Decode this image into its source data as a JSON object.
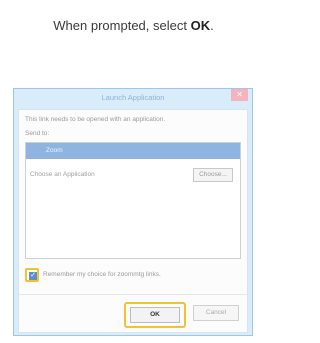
{
  "instruction": {
    "prefix": "When prompted, select ",
    "emphasis": "OK",
    "suffix": "."
  },
  "dialog": {
    "title": "Launch Application",
    "close_icon": "close-icon",
    "message": "This link needs to be opened with an application.",
    "send_to_label": "Send to:",
    "selected_item": "Zoom",
    "choose_label": "Choose an Application",
    "choose_button": "Choose...",
    "remember_label": "Remember my choice for zoommtg links.",
    "remember_checked": true,
    "ok_button": "OK",
    "cancel_button": "Cancel"
  },
  "colors": {
    "highlight": "#f2c230",
    "selection": "#8fb4e2",
    "dialog_frame": "#d9ecfa"
  }
}
